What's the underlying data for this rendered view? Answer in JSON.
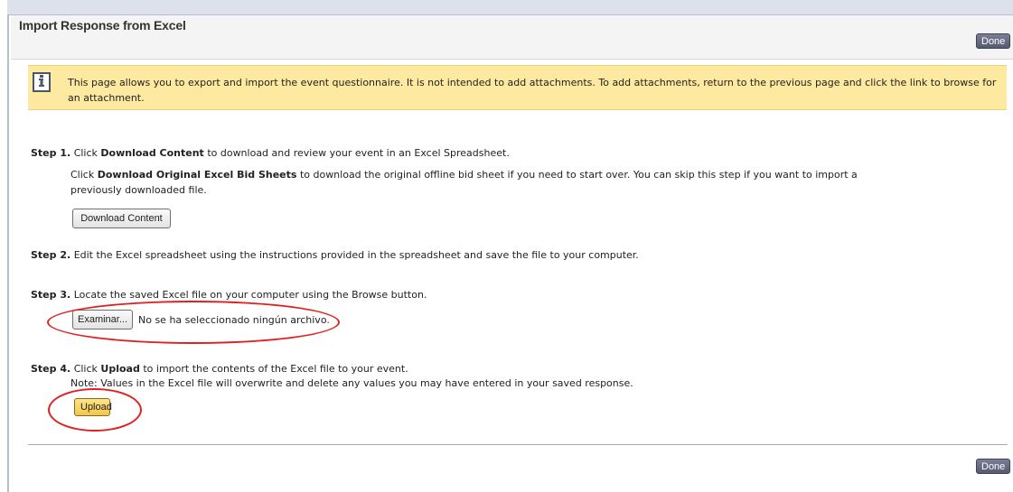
{
  "header": {
    "title": "Import Response from Excel",
    "done_label": "Done"
  },
  "info": {
    "icon": "info-icon",
    "text": "This page allows you to export and import the event questionnaire. It is not intended to add attachments. To add attachments, return to the previous page and click the link to browse for an attachment."
  },
  "step1": {
    "label": "Step 1.",
    "text_pre": "Click",
    "bold": "Download Content",
    "text_post": "to download and review your event in an Excel Spreadsheet.",
    "line2_pre": "Click",
    "line2_bold": "Download Original Excel Bid Sheets",
    "line2_post": "to download the original offline bid sheet if you need to start over. You can skip this step if you want to import a previously downloaded file.",
    "button_label": "Download Content"
  },
  "step2": {
    "label": "Step 2.",
    "text": "Edit the Excel spreadsheet using the instructions provided in the spreadsheet and save the file to your computer."
  },
  "step3": {
    "label": "Step 3.",
    "text": "Locate the saved Excel file on your computer using the Browse button.",
    "browse_label": "Examinar...",
    "file_status": "No se ha seleccionado ningún archivo."
  },
  "step4": {
    "label": "Step 4.",
    "text_pre": "Click",
    "bold": "Upload",
    "text_post": "to import the contents of the Excel file to your event.",
    "note": "Note: Values in the Excel file will overwrite and delete any values you may have entered in your saved response.",
    "upload_label": "Upload"
  },
  "footer": {
    "done_label": "Done"
  },
  "colors": {
    "info_bg": "#fde9a0",
    "upload_bg": "#f3c64a",
    "highlight_oval": "#e02020",
    "done_bg": "#555a70"
  }
}
